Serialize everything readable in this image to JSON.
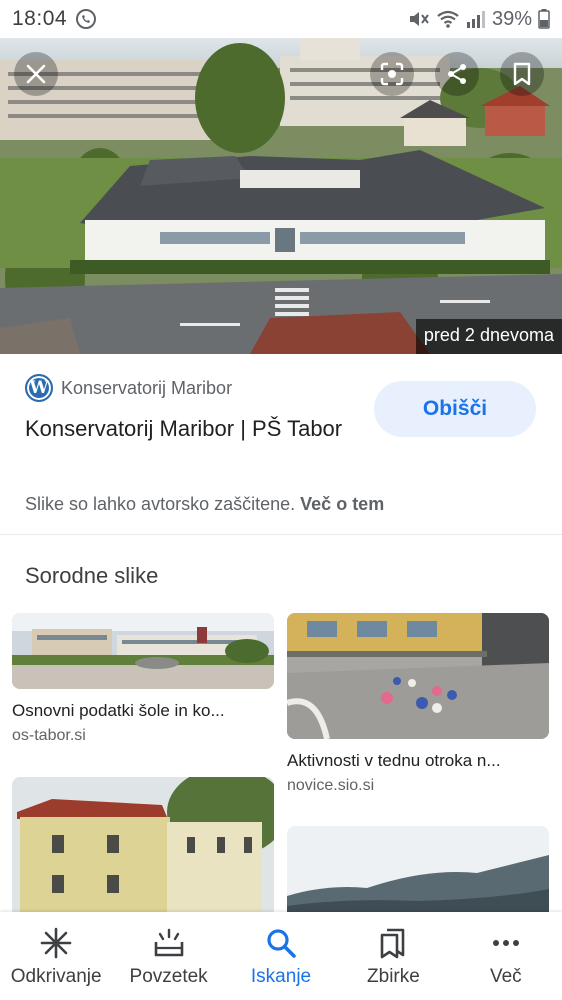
{
  "status_bar": {
    "time": "18:04",
    "battery": "39%"
  },
  "hero": {
    "timestamp": "pred 2 dnevoma"
  },
  "source": {
    "site_name": "Konservatorij Maribor",
    "title": "Konservatorij Maribor | PŠ Tabor",
    "visit_label": "Obišči",
    "copyright_text": "Slike so lahko avtorsko zaščitene.",
    "learn_more": "Več o tem"
  },
  "related": {
    "heading": "Sorodne slike",
    "items": [
      {
        "title": "Osnovni podatki šole in ko...",
        "domain": "os-tabor.si"
      },
      {
        "title": "Aktivnosti v tednu otroka n...",
        "domain": "novice.sio.si"
      },
      {
        "title": "",
        "domain": ""
      },
      {
        "title": "",
        "domain": ""
      }
    ]
  },
  "nav": {
    "items": [
      {
        "label": "Odkrivanje",
        "icon": "asterisk-icon"
      },
      {
        "label": "Povzetek",
        "icon": "updates-icon"
      },
      {
        "label": "Iskanje",
        "icon": "search-icon"
      },
      {
        "label": "Zbirke",
        "icon": "collections-icon"
      },
      {
        "label": "Več",
        "icon": "more-icon"
      }
    ],
    "active_index": 2
  },
  "colors": {
    "accent": "#1a73e8",
    "accent_bg": "#e8f0fe",
    "text": "#202124",
    "muted": "#5f6368"
  }
}
